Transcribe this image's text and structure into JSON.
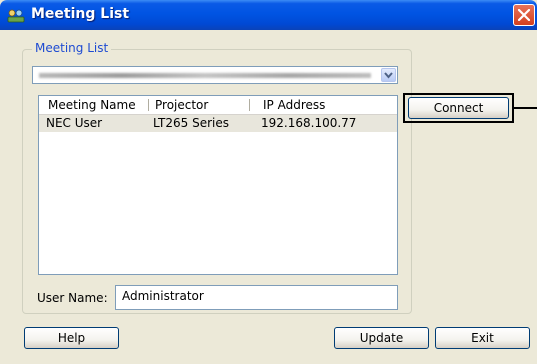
{
  "window": {
    "title": "Meeting List",
    "icon": "meeting-list-app-icon",
    "close_icon": "close-icon"
  },
  "group": {
    "legend": "Meeting List"
  },
  "adapter_select": {
    "value": "",
    "icon": "chevron-down-icon"
  },
  "list": {
    "columns": [
      "Meeting Name",
      "Projector",
      "IP Address"
    ],
    "rows": [
      {
        "meeting_name": "NEC User",
        "projector": "LT265 Series",
        "ip_address": "192.168.100.77"
      }
    ]
  },
  "buttons": {
    "connect": "Connect",
    "help": "Help",
    "update": "Update",
    "exit": "Exit"
  },
  "user": {
    "label": "User Name:",
    "value": "Administrator"
  },
  "colors": {
    "titlebar": "#0054e3",
    "window_bg": "#ece9d8",
    "legend_text": "#1e4bd2",
    "close_button": "#d4401e"
  }
}
